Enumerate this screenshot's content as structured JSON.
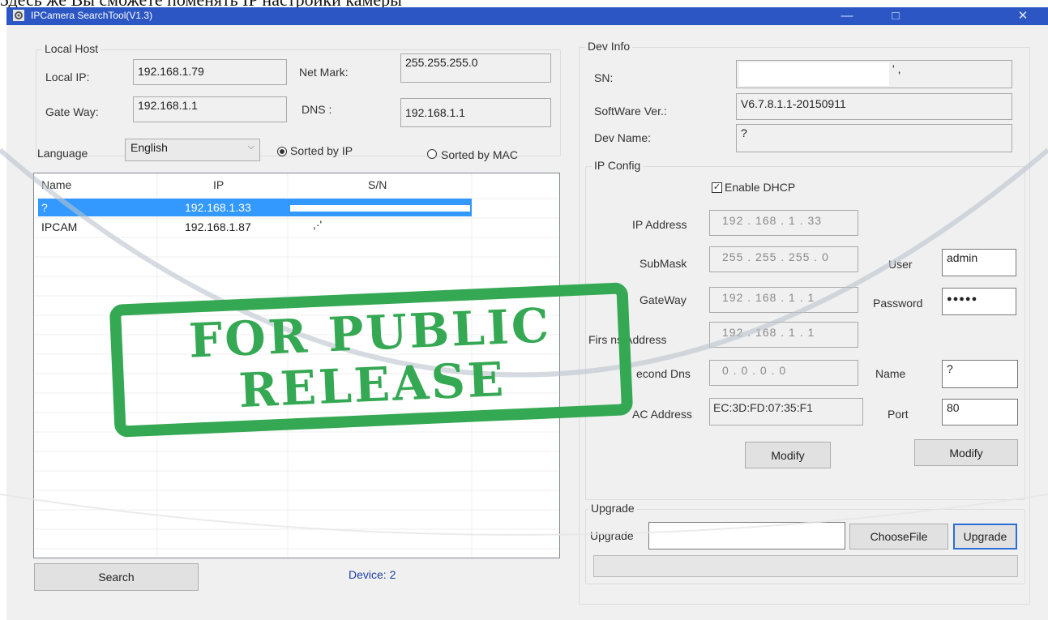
{
  "caption": "Здесь же Вы сможете поменять IP настройки камеры",
  "window": {
    "title": "IPCamera SearchTool(V1.3)",
    "minimize": "—",
    "maximize": "□",
    "close": "✕"
  },
  "local_host": {
    "legend": "Local Host",
    "local_ip_label": "Local IP:",
    "local_ip": "192.168.1.79",
    "netmask_label": "Net Mark:",
    "netmask": "255.255.255.0",
    "gateway_label": "Gate Way:",
    "gateway": "192.168.1.1",
    "dns_label": "DNS :",
    "dns": "192.168.1.1"
  },
  "language": {
    "label": "Language",
    "selected": "English"
  },
  "sort": {
    "by_ip": "Sorted by IP",
    "by_mac": "Sorted by MAC",
    "selected": "ip"
  },
  "device_list": {
    "columns": [
      "Name",
      "IP",
      "S/N"
    ],
    "rows": [
      {
        "name": "?",
        "ip": "192.168.1.33",
        "sn": "",
        "selected": true
      },
      {
        "name": "IPCAM",
        "ip": "192.168.1.87",
        "sn": ",·'",
        "selected": false
      }
    ]
  },
  "search_button": "Search",
  "device_count": "Device: 2",
  "dev_info": {
    "legend": "Dev Info",
    "sn_label": "SN:",
    "sn": "' ,",
    "software_label": "SoftWare Ver.:",
    "software": "V6.7.8.1.1-20150911",
    "devname_label": "Dev Name:",
    "devname": "?"
  },
  "ip_config": {
    "legend": "IP Config",
    "dhcp_label": "Enable DHCP",
    "dhcp_checked": true,
    "ip_label": "IP Address",
    "ip": "192 . 168 . 1 . 33",
    "submask_label": "SubMask",
    "submask": "255 . 255 . 255 . 0",
    "gateway_label": "GateWay",
    "gateway": "192 . 168 . 1 . 1",
    "first_dns_label": "Firs ns Address",
    "first_dns": "192 . 168 . 1 . 1",
    "second_dns_label": "econd Dns",
    "second_dns": "0 . 0 . 0 . 0",
    "mac_label": "AC Address",
    "mac": "EC:3D:FD:07:35:F1",
    "user_label": "User",
    "user": "admin",
    "password_label": "Password",
    "password": "●●●●●",
    "name_label": "Name",
    "name": "?",
    "port_label": "Port",
    "port": "80",
    "modify_left": "Modify",
    "modify_right": "Modify"
  },
  "upgrade": {
    "legend": "Upgrade",
    "label": "Upgrade",
    "file": "",
    "choose_button": "ChooseFile",
    "upgrade_button": "Upgrade",
    "progress": 0
  },
  "stamp": {
    "line1": "FOR PUBLIC",
    "line2": "RELEASE",
    "color": "#34a853"
  },
  "colors": {
    "titlebar": "#2b56c4",
    "selection": "#3399ff",
    "device_count": "#1f3ea8"
  }
}
